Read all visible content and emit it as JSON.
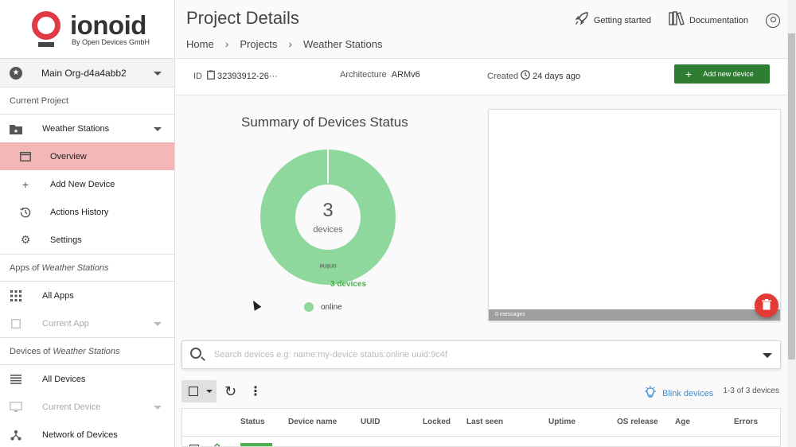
{
  "logo": {
    "name": "ionoid",
    "tagline": "By Open Devices GmbH"
  },
  "org": {
    "name": "Main Org-d4a4abb2"
  },
  "sidebar": {
    "current_project_label": "Current Project",
    "project": "Weather Stations",
    "project_items": [
      "Overview",
      "Add New Device",
      "Actions History",
      "Settings"
    ],
    "apps_label_prefix": "Apps of",
    "apps_label_project": "Weather Stations",
    "all_apps": "All Apps",
    "current_app": "Current App",
    "devices_label_prefix": "Devices of",
    "devices_label_project": "Weather Stations",
    "all_devices": "All Devices",
    "current_device": "Current Device",
    "network": "Network of Devices"
  },
  "header": {
    "title": "Project Details",
    "breadcrumb": [
      "Home",
      "Projects",
      "Weather Stations"
    ],
    "getting_started": "Getting started",
    "documentation": "Documentation"
  },
  "info": {
    "id_label": "ID",
    "id_value": "32393912-26···",
    "arch_label": "Architecture",
    "arch_value": "ARMv6",
    "created_label": "Created",
    "created_value": "24 days ago",
    "add_button": "Add new device"
  },
  "summary": {
    "title": "Summary of Devices Status",
    "center_number": "3",
    "center_label": "devices",
    "slice_label": "online",
    "devices_count": "3 devices",
    "legend": "online",
    "slice_color": "#8fd89d"
  },
  "chart_data": {
    "type": "pie",
    "categories": [
      "online"
    ],
    "values": [
      3
    ],
    "title": "Summary of Devices Status"
  },
  "messages": {
    "footer": "0 messages"
  },
  "search": {
    "placeholder": "Search devices e.g: name:my-device status:online uuid:9c4f"
  },
  "toolbar": {
    "blink": "Blink devices",
    "count": "1-3 of 3 devices"
  },
  "table": {
    "columns": [
      "Status",
      "Device name",
      "UUID",
      "Locked",
      "Last seen",
      "Uptime",
      "OS release",
      "Age",
      "Errors"
    ]
  }
}
